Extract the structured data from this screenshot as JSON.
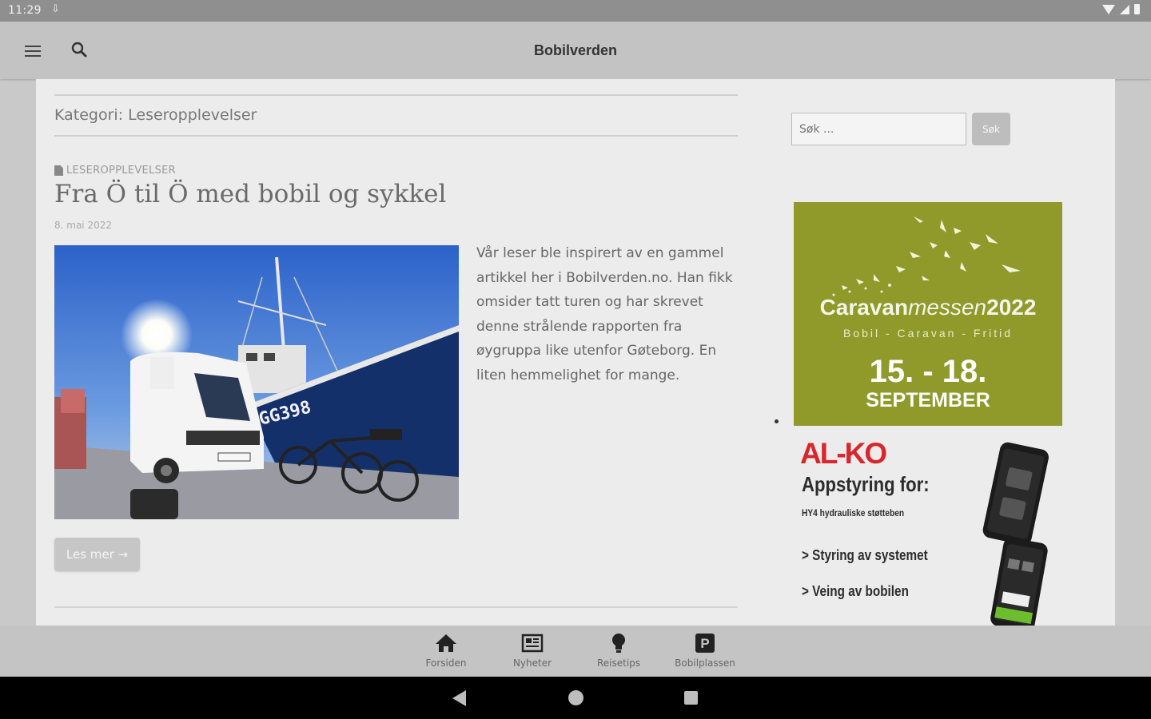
{
  "status_bar": {
    "time": "11:29"
  },
  "app_bar": {
    "title": "Bobilverden"
  },
  "category": {
    "title": "Kategori: Leseropplevelser"
  },
  "post": {
    "category": "LESEROPPLEVELSER",
    "title": "Fra Ö til Ö med bobil og sykkel",
    "date": "8. mai 2022",
    "excerpt": "Vår leser ble inspirert av en gammel artikkel her i Bobilverden.no. Han fikk omsider tatt turen og har skrevet denne strålende rapporten fra øygruppa like utenfor Gøteborg. En liten hemmelighet for mange.",
    "read_more": "Les mer →",
    "image_boat_text": "GG398"
  },
  "sidebar": {
    "search_placeholder": "Søk ...",
    "search_button": "Søk"
  },
  "ad_caravan": {
    "brand_bold": "Caravan",
    "brand_light": "messen",
    "year": "2022",
    "subtitle": "Bobil - Caravan - Fritid",
    "dates": "15. - 18.",
    "month": "SEPTEMBER",
    "bg_color": "#8f9a2b"
  },
  "ad_alko": {
    "logo": "AL-KO",
    "headline": "Appstyring for:",
    "subline": "HY4 hydrauliske støtteben",
    "bullet1": "> Styring av systemet",
    "bullet2": "> Veing av bobilen",
    "logo_color": "#d8262d"
  },
  "bottom_nav": {
    "items": [
      {
        "label": "Forsiden",
        "icon": "home-icon"
      },
      {
        "label": "Nyheter",
        "icon": "newspaper-icon"
      },
      {
        "label": "Reisetips",
        "icon": "lightbulb-icon"
      },
      {
        "label": "Bobilplassen",
        "icon": "parking-icon"
      }
    ]
  }
}
